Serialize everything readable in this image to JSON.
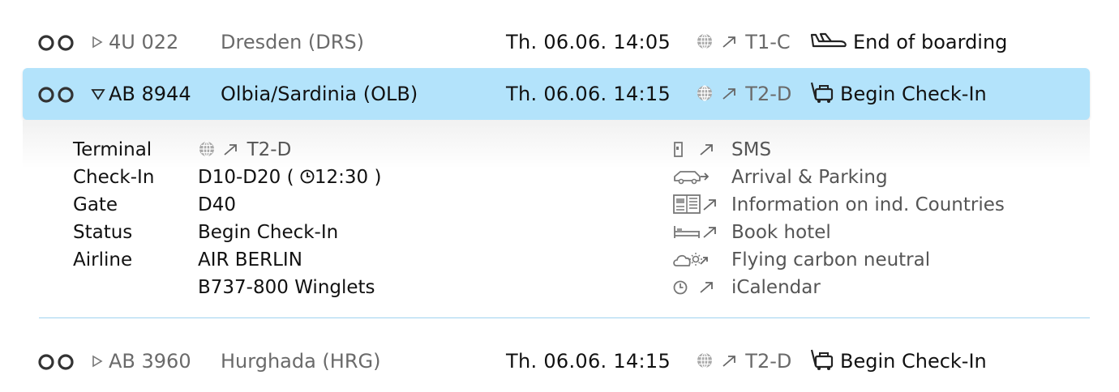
{
  "flights": [
    {
      "flight_no": "4U 022",
      "destination": "Dresden (DRS)",
      "departure": "Th. 06.06. 14:05",
      "terminal": "T1-C",
      "status": "End of boarding",
      "status_icon": "plane-landing-icon",
      "expanded": false
    },
    {
      "flight_no": "AB 8944",
      "destination": "Olbia/Sardinia (OLB)",
      "departure": "Th. 06.06. 14:15",
      "terminal": "T2-D",
      "status": "Begin Check-In",
      "status_icon": "check-in-desk-icon",
      "expanded": true
    },
    {
      "flight_no": "AB 3960",
      "destination": "Hurghada (HRG)",
      "departure": "Th. 06.06. 14:15",
      "terminal": "T2-D",
      "status": "Begin Check-In",
      "status_icon": "check-in-desk-icon",
      "expanded": false
    }
  ],
  "details": {
    "labels": {
      "terminal": "Terminal",
      "checkin": "Check-In",
      "gate": "Gate",
      "status": "Status",
      "airline": "Airline"
    },
    "terminal": "T2-D",
    "checkin": "D10-D20 (",
    "checkin_time": "12:30",
    "checkin_close": ")",
    "gate": "D40",
    "status": "Begin Check-In",
    "airline": "AIR BERLIN",
    "aircraft": "B737-800 Winglets"
  },
  "links": [
    {
      "label": "SMS",
      "icon": "mobile-phone-icon"
    },
    {
      "label": "Arrival & Parking",
      "icon": "car-icon"
    },
    {
      "label": "Information on ind. Countries",
      "icon": "country-info-icon"
    },
    {
      "label": "Book hotel",
      "icon": "bed-icon"
    },
    {
      "label": "Flying carbon neutral",
      "icon": "cloud-sun-icon"
    },
    {
      "label": "iCalendar",
      "icon": "clock-icon"
    }
  ],
  "colors": {
    "selected_row": "#b3e3fb",
    "divider": "#9fd3ef",
    "muted_text": "#6a6a6a"
  }
}
